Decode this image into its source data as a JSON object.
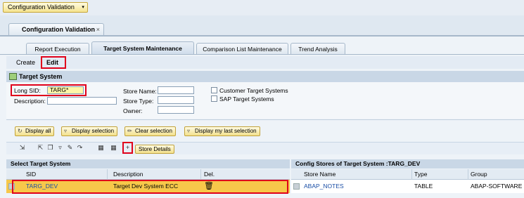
{
  "app_menu": {
    "label": "Configuration Validation"
  },
  "main_tab": {
    "label": "Configuration Validation",
    "close": "×"
  },
  "sub_tabs": [
    "Report Execution",
    "Target System Maintenance",
    "Comparison List Maintenance",
    "Trend Analysis"
  ],
  "toolbar": {
    "create": "Create",
    "edit": "Edit"
  },
  "section": {
    "title": "Target System"
  },
  "form": {
    "long_sid_label": "Long SID:",
    "long_sid_value": "TARG*",
    "description_label": "Description:",
    "store_name_label": "Store Name:",
    "store_type_label": "Store Type:",
    "owner_label": "Owner:",
    "customer_target_systems": "Customer Target Systems",
    "sap_target_systems": "SAP Target Systems"
  },
  "actions": {
    "display_all": "Display all",
    "display_selection": "Display selection",
    "clear_selection": "Clear selection",
    "display_last_selection": "Display my last selection"
  },
  "store_details": "Store Details",
  "left_table": {
    "title": "Select Target System",
    "columns": [
      "SID",
      "Description",
      "Del."
    ],
    "rows": [
      {
        "sid": "TARG_DEV",
        "description": "Target Dev System ECC"
      }
    ]
  },
  "right_table": {
    "title": "Config Stores of Target System :TARG_DEV",
    "columns": [
      "Store Name",
      "Type",
      "Group"
    ],
    "rows": [
      {
        "store_name": "ABAP_NOTES",
        "type": "TABLE",
        "group": "ABAP-SOFTWARE"
      }
    ]
  },
  "colors": {
    "highlight": "#e0001b",
    "selected_row": "#f7c84a",
    "link": "#1a4ea6"
  }
}
